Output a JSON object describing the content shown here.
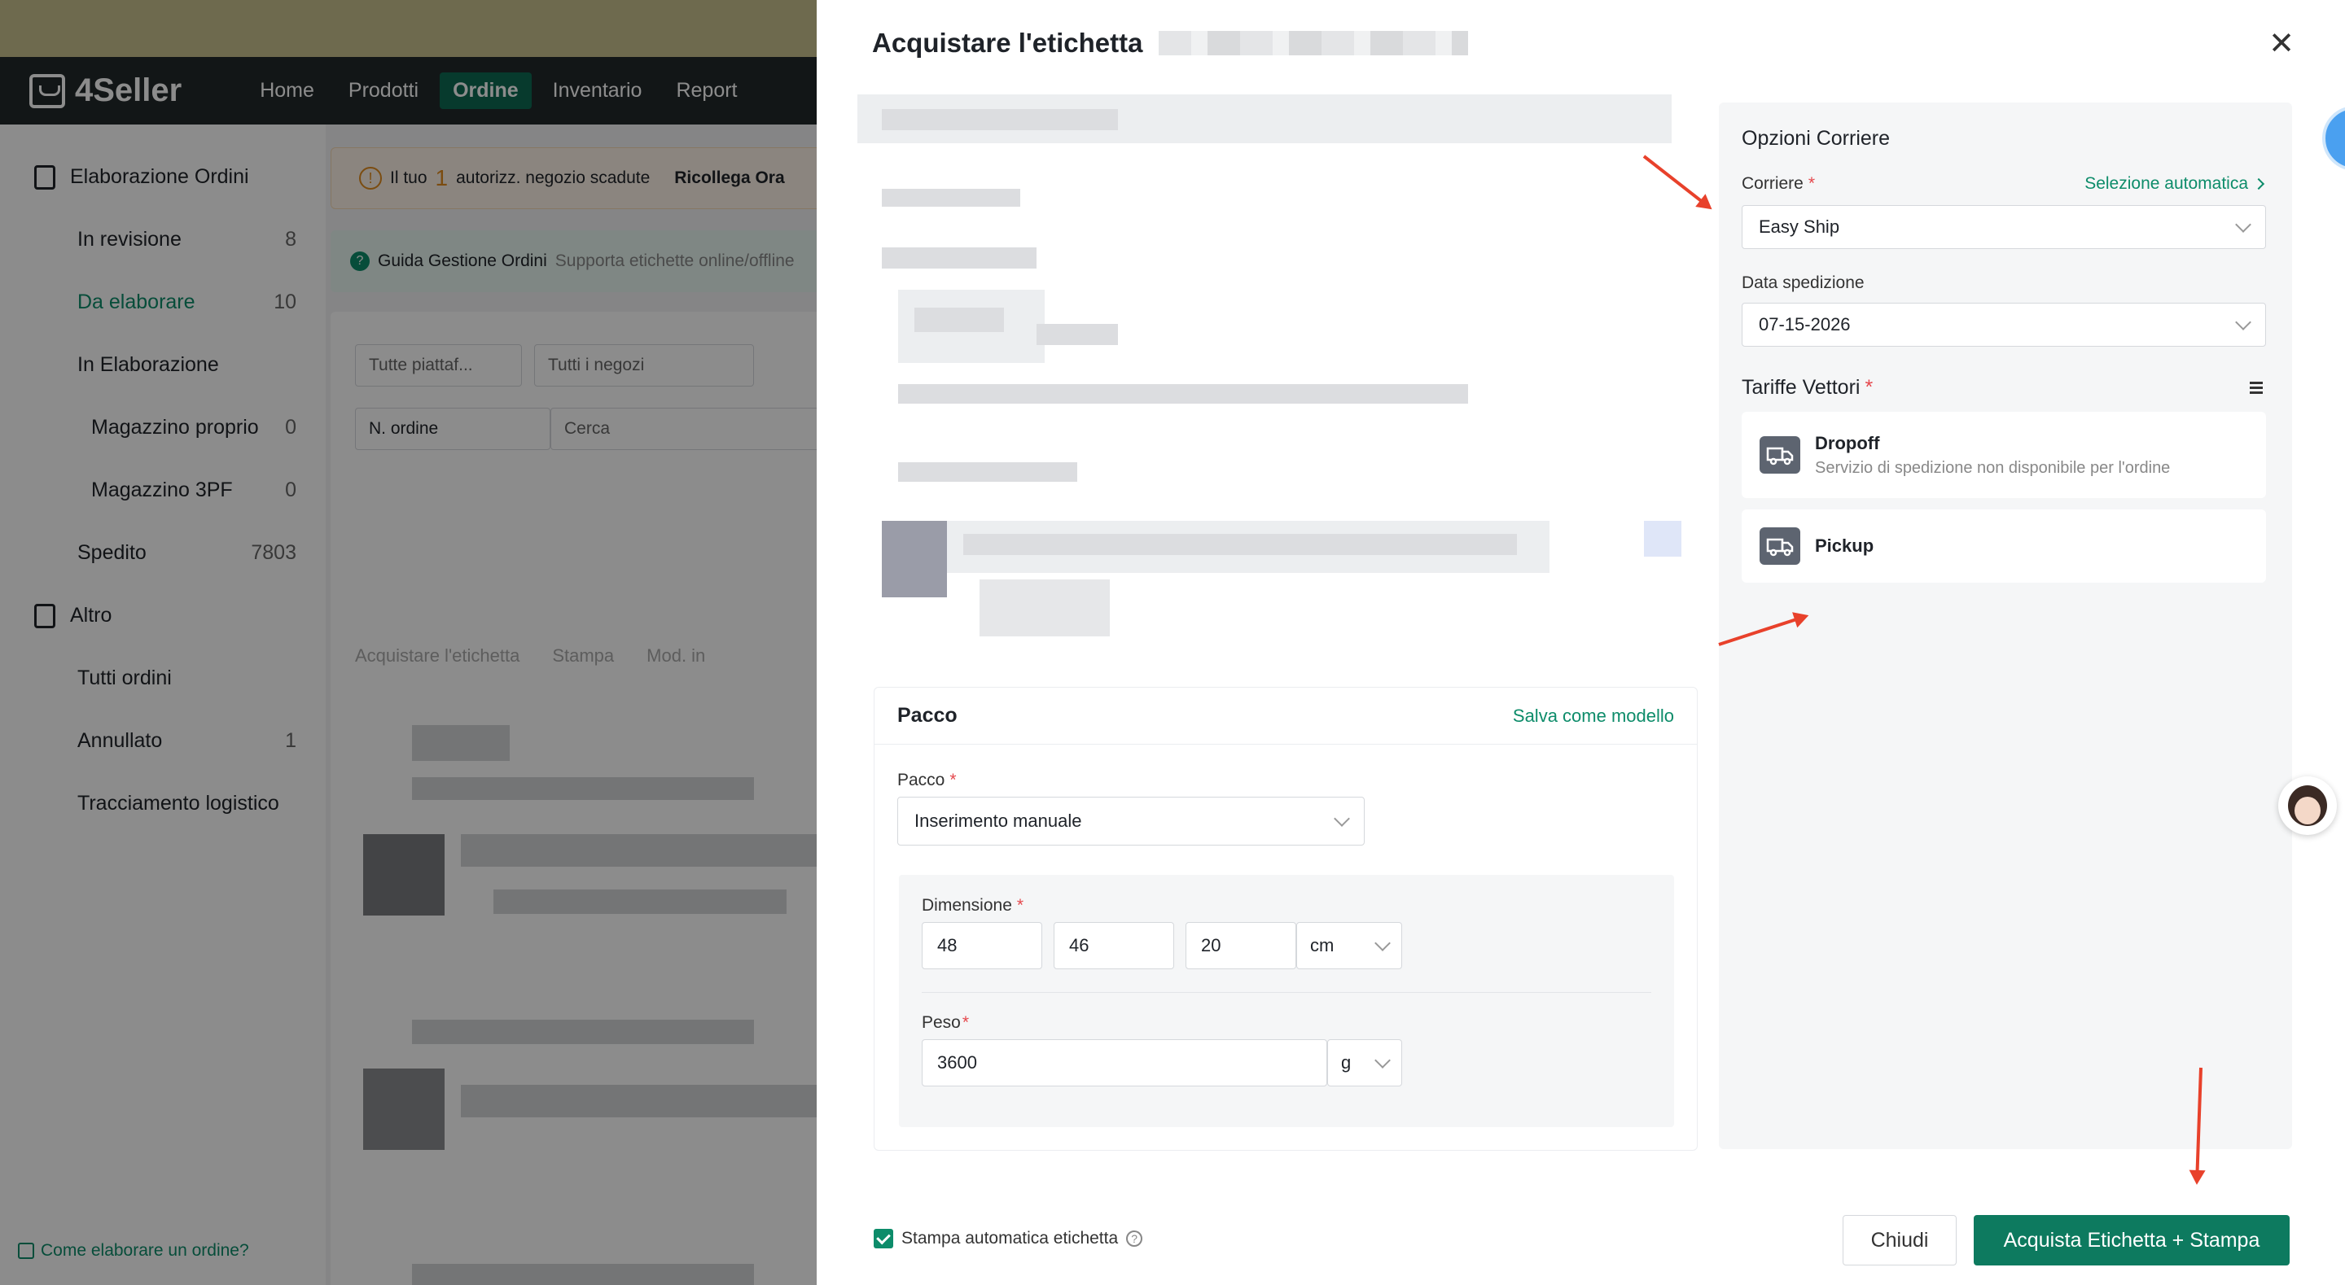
{
  "app": {
    "brand": "4Seller",
    "nav": [
      "Home",
      "Prodotti",
      "Ordine",
      "Inventario",
      "Report"
    ],
    "active_nav": "Ordine"
  },
  "sidebar": {
    "groups": [
      {
        "label": "Elaborazione Ordini",
        "items": [
          {
            "label": "In revisione",
            "count": "8"
          },
          {
            "label": "Da elaborare",
            "count": "10",
            "active": true
          },
          {
            "label": "In Elaborazione",
            "count": ""
          },
          {
            "label": "Magazzino proprio",
            "count": "0",
            "sub": true
          },
          {
            "label": "Magazzino 3PF",
            "count": "0",
            "sub": true
          },
          {
            "label": "Spedito",
            "count": "7803"
          }
        ]
      },
      {
        "label": "Altro",
        "items": [
          {
            "label": "Tutti ordini",
            "count": ""
          },
          {
            "label": "Annullato",
            "count": "1"
          },
          {
            "label": "Tracciamento logistico",
            "count": ""
          }
        ]
      }
    ],
    "footer_link": "Come elaborare un ordine?"
  },
  "main": {
    "banner_warning_prefix": "Il tuo",
    "banner_warning_num": "1",
    "banner_warning_suffix": "autorizz. negozio scadute",
    "banner_warning_link": "Ricollega Ora",
    "banner_guide_title": "Guida Gestione Ordini",
    "banner_guide_desc": "Supporta etichette online/offline",
    "filter_platform": "Tutte piattaf...",
    "filter_shop": "Tutti i negozi",
    "filter_order_type": "N. ordine",
    "search_placeholder": "Cerca",
    "toolbar_buy": "Acquistare l'etichetta",
    "toolbar_print": "Stampa",
    "toolbar_mod": "Mod. in"
  },
  "drawer": {
    "title": "Acquistare l'etichetta",
    "pacco": {
      "title": "Pacco",
      "save_template": "Salva come modello",
      "package_label": "Pacco",
      "package_value": "Inserimento manuale",
      "dimension_label": "Dimensione",
      "length": "48",
      "width": "46",
      "height": "20",
      "dim_unit": "cm",
      "weight_label": "Peso",
      "weight": "3600",
      "weight_unit": "g"
    },
    "carrier": {
      "title": "Opzioni Corriere",
      "carrier_label": "Corriere",
      "auto_select": "Selezione automatica",
      "carrier_value": "Easy Ship",
      "ship_date_label": "Data spedizione",
      "ship_date_value": "07-15-2026",
      "rates_label": "Tariffe Vettori",
      "rates": [
        {
          "name": "Dropoff",
          "desc": "Servizio di spedizione non disponibile per l'ordine"
        },
        {
          "name": "Pickup",
          "desc": ""
        }
      ]
    },
    "footer": {
      "auto_print_label": "Stampa automatica etichetta",
      "close_label": "Chiudi",
      "buy_print_label": "Acquista Etichetta + Stampa"
    }
  },
  "colors": {
    "brand_green": "#0d7a5f",
    "link_green": "#0d8c6a",
    "annotation_red": "#e8412b",
    "nav_dark": "#22282b"
  }
}
